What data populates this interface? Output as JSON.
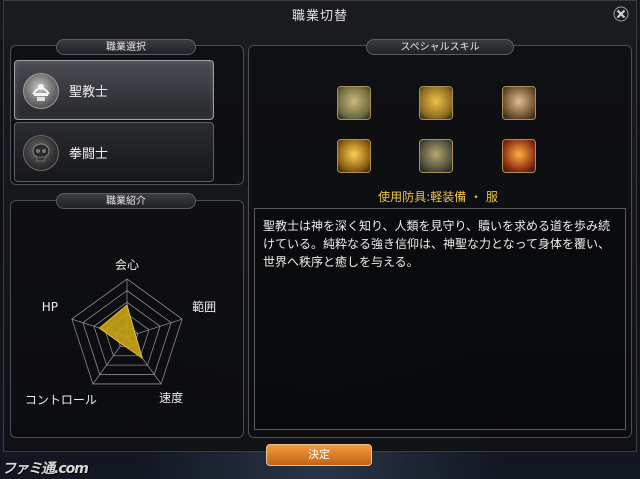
{
  "window": {
    "title": "職業切替"
  },
  "job_select": {
    "label": "職業選択",
    "jobs": [
      {
        "name": "聖教士",
        "selected": true
      },
      {
        "name": "拳闘士",
        "selected": false
      }
    ]
  },
  "job_intro": {
    "label": "職業紹介",
    "stats": {
      "labels": [
        "会心",
        "範囲",
        "速度",
        "コントロール",
        "HP"
      ],
      "values": [
        0.55,
        0.15,
        0.45,
        0.15,
        0.5
      ],
      "fill_color": "#c9a416"
    }
  },
  "special_skill": {
    "label": "スペシャルスキル",
    "skills": [
      {
        "icon": "stacked-coins-icon",
        "colors": [
          "#6d6a3e",
          "#c9b87a"
        ]
      },
      {
        "icon": "golden-heart-icon",
        "colors": [
          "#8a6a20",
          "#f0c04a"
        ]
      },
      {
        "icon": "drum-banner-icon",
        "colors": [
          "#6a4a2a",
          "#e0c090"
        ]
      },
      {
        "icon": "light-burst-icon",
        "colors": [
          "#8a5a10",
          "#ffd050"
        ]
      },
      {
        "icon": "armor-helmet-icon",
        "colors": [
          "#4a4a3a",
          "#b8a870"
        ]
      },
      {
        "icon": "holy-flame-icon",
        "colors": [
          "#8a2a10",
          "#ffb040"
        ]
      }
    ],
    "equipment": "使用防具:軽装備 ・ 服",
    "description": "聖教士は神を深く知り、人類を見守り、贖いを求める道を歩み続けている。純粋なる強き信仰は、神聖な力となって身体を覆い、世界へ秩序と癒しを与える。"
  },
  "decide_button": {
    "label": "決定"
  },
  "watermark": {
    "text": "ファミ通.com"
  }
}
